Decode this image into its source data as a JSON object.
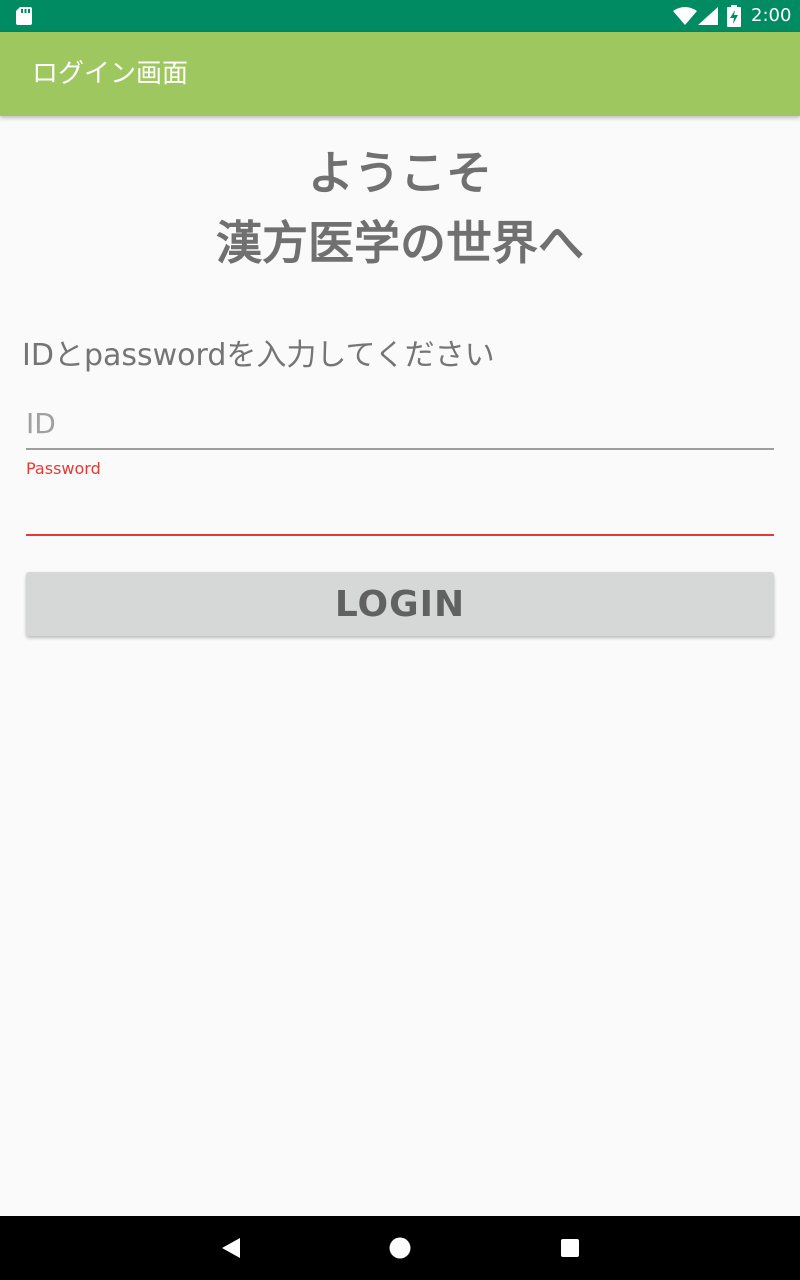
{
  "status_bar": {
    "time": "2:00",
    "icons": [
      "sd-card-icon",
      "wifi-icon",
      "cell-signal-icon",
      "battery-charging-icon"
    ]
  },
  "app_bar": {
    "title": "ログイン画面"
  },
  "main": {
    "welcome_line1": "ようこそ",
    "welcome_line2": "漢方医学の世界へ",
    "instruction": "IDとpasswordを入力してください",
    "id_field": {
      "placeholder": "ID",
      "value": ""
    },
    "password_field": {
      "label": "Password",
      "value": ""
    },
    "login_button": "LOGIN"
  },
  "nav_bar": {
    "icons": [
      "back-icon",
      "home-icon",
      "recents-icon"
    ]
  },
  "colors": {
    "status_bar": "#008b62",
    "app_bar": "#9fc760",
    "background": "#fafafa",
    "error_accent": "#e53935",
    "button": "#d6d7d7",
    "heading_text": "#707070"
  }
}
